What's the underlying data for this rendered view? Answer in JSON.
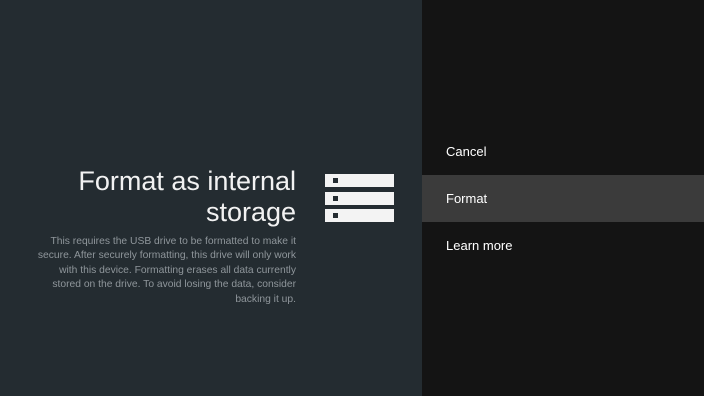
{
  "dialog": {
    "title_line1": "Format as internal",
    "title_line2": "storage",
    "description": "This requires the USB drive to be formatted to make it secure. After securely formatting, this drive will only work with this device. Formatting erases all data currently stored on the drive. To avoid losing the data, consider backing it up.",
    "icon": "storage-drive-icon"
  },
  "actions": {
    "items": [
      {
        "label": "Cancel",
        "selected": false
      },
      {
        "label": "Format",
        "selected": true
      },
      {
        "label": "Learn more",
        "selected": false
      }
    ]
  },
  "colors": {
    "left_background": "#242c31",
    "right_background": "#141414",
    "selected_background": "#3b3b3b"
  }
}
